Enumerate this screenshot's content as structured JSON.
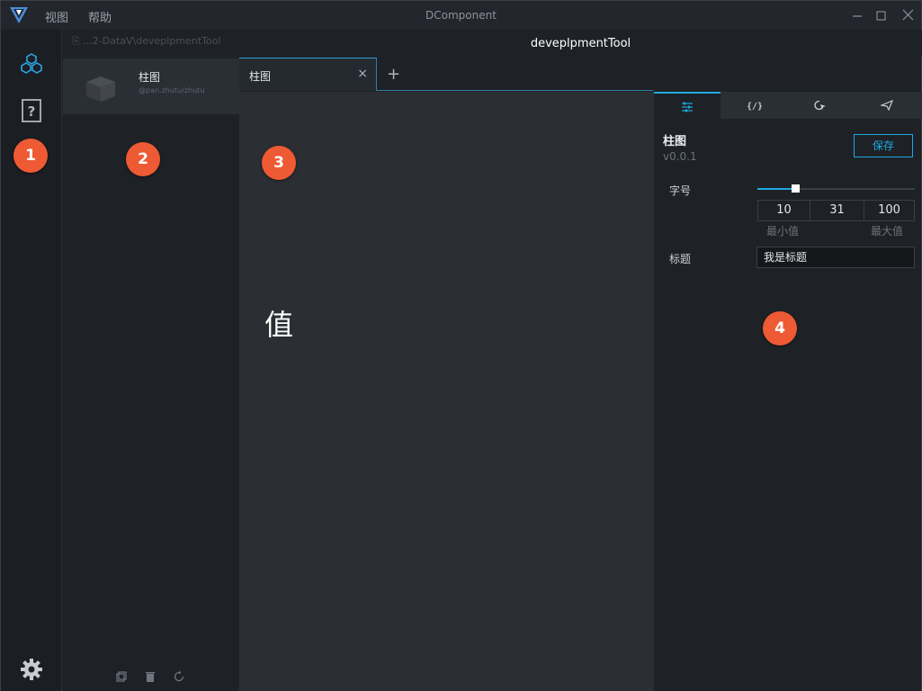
{
  "window": {
    "title": "DComponent",
    "menu": [
      "视图",
      "帮助"
    ],
    "controls": [
      "minimize",
      "maximize",
      "close"
    ]
  },
  "activity_bar": {
    "icons": [
      "components-icon",
      "help-icon",
      "settings-icon"
    ]
  },
  "component_panel": {
    "path": "...2-DataV\\deveplpmentTool",
    "items": [
      {
        "name": "柱图",
        "package": "@pan.zhutu/zhutu"
      }
    ],
    "tools": [
      "copy-icon",
      "trash-icon",
      "refresh-icon"
    ]
  },
  "header": {
    "title": "deveplpmentTool"
  },
  "tabs": [
    {
      "label": "柱图",
      "close": "×"
    }
  ],
  "tab_add": "+",
  "canvas": {
    "value_text": "值"
  },
  "properties": {
    "tabs": [
      "config-tab",
      "code-tab",
      "interaction-tab",
      "publish-tab"
    ],
    "component_name": "柱图",
    "version": "v0.0.1",
    "save_label": "保存",
    "font_size": {
      "label": "字号",
      "min": "10",
      "value": "31",
      "max": "100",
      "fill_fraction": 0.24,
      "min_caption": "最小值",
      "max_caption": "最大值"
    },
    "title_field": {
      "label": "标题",
      "value": "我是标题"
    }
  },
  "annotations": [
    "1",
    "2",
    "3",
    "4"
  ],
  "colors": {
    "accent": "#1ea9e1",
    "badge": "#ee5a33",
    "canvas": "#2b2e32"
  }
}
